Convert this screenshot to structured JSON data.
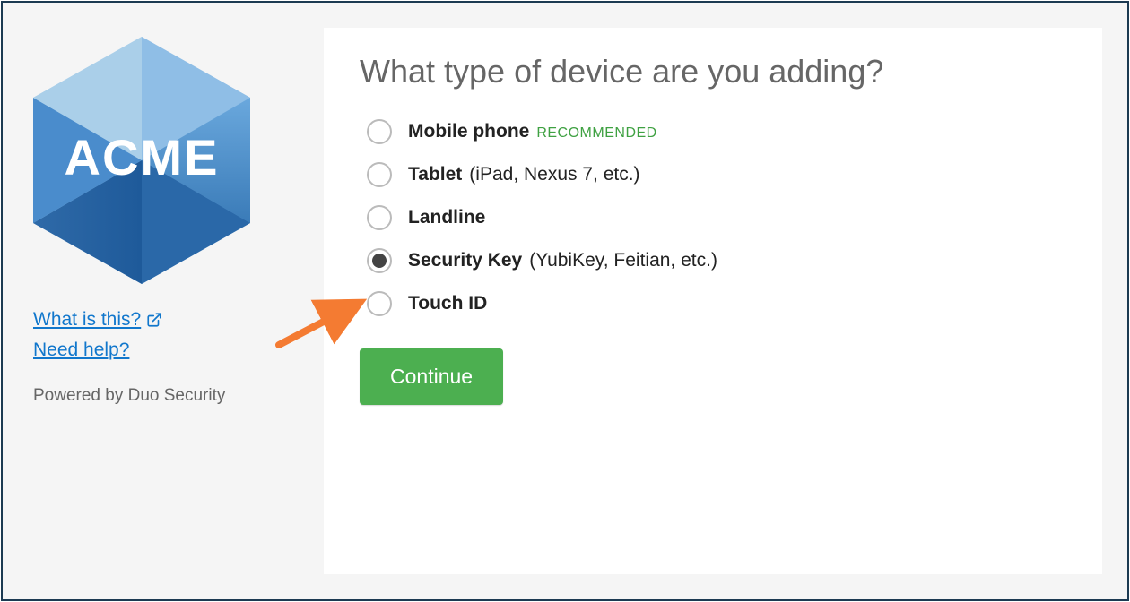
{
  "sidebar": {
    "logo_text": "ACME",
    "links": {
      "what_is_this": "What is this?",
      "need_help": "Need help?"
    },
    "powered_by": "Powered by Duo Security"
  },
  "main": {
    "heading": "What type of device are you adding?",
    "options": [
      {
        "id": "mobile-phone",
        "label_bold": "Mobile phone",
        "label_sub": "",
        "badge": "RECOMMENDED",
        "selected": false
      },
      {
        "id": "tablet",
        "label_bold": "Tablet",
        "label_sub": "(iPad, Nexus 7, etc.)",
        "badge": "",
        "selected": false
      },
      {
        "id": "landline",
        "label_bold": "Landline",
        "label_sub": "",
        "badge": "",
        "selected": false
      },
      {
        "id": "security-key",
        "label_bold": "Security Key",
        "label_sub": "(YubiKey, Feitian, etc.)",
        "badge": "",
        "selected": true
      },
      {
        "id": "touch-id",
        "label_bold": "Touch ID",
        "label_sub": "",
        "badge": "",
        "selected": false
      }
    ],
    "continue_label": "Continue"
  },
  "colors": {
    "accent_link": "#1177cc",
    "button_green": "#4caf50",
    "recommended_green": "#3fa142",
    "annotation_arrow": "#f47b32"
  }
}
